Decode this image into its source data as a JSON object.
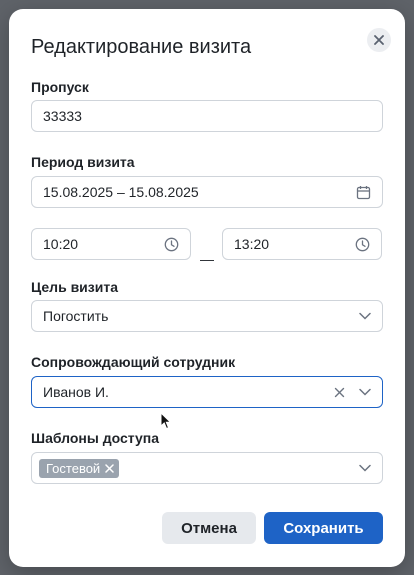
{
  "dialog": {
    "title": "Редактирование визита"
  },
  "pass": {
    "label": "Пропуск",
    "value": "33333"
  },
  "period": {
    "label": "Период визита",
    "date_range": "15.08.2025 – 15.08.2025",
    "time_from": "10:20",
    "time_separator": "—",
    "time_to": "13:20"
  },
  "purpose": {
    "label": "Цель визита",
    "value": "Погостить"
  },
  "escort": {
    "label": "Сопровождающий сотрудник",
    "value": "Иванов И."
  },
  "templates": {
    "label": "Шаблоны доступа",
    "chips": [
      "Гостевой"
    ]
  },
  "actions": {
    "cancel_label": "Отмена",
    "save_label": "Сохранить"
  },
  "colors": {
    "primary": "#1e63c6",
    "chip": "#9aa3ae",
    "field_border": "#cfd4da"
  }
}
